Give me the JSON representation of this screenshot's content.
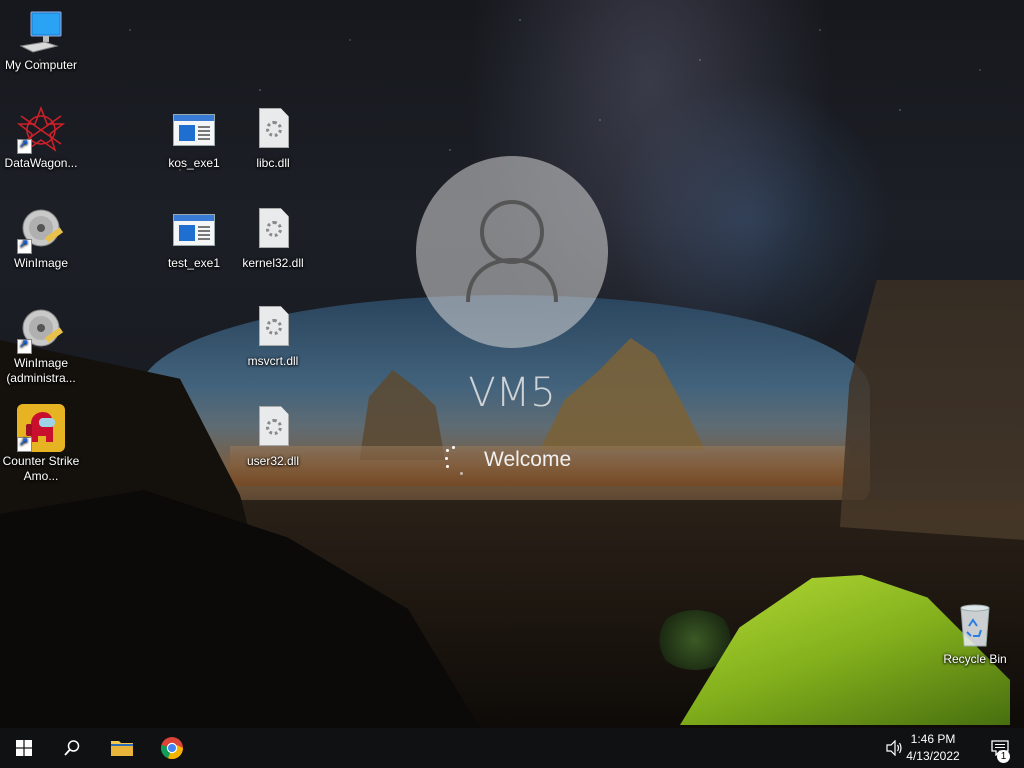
{
  "lockscreen": {
    "username": "VM5",
    "status": "Welcome"
  },
  "desktop": {
    "icons": [
      {
        "label": "My Computer",
        "icon": "computer-icon"
      },
      {
        "label": "DataWagon...",
        "icon": "datawagon-icon"
      },
      {
        "label": "WinImage",
        "icon": "winimage-disc-icon"
      },
      {
        "label": "WinImage (administra...",
        "icon": "winimage-disc-icon"
      },
      {
        "label": "Counter Strike Amo...",
        "icon": "among-us-icon"
      },
      {
        "label": "kos_exe1",
        "icon": "exe-window-icon"
      },
      {
        "label": "test_exe1",
        "icon": "exe-window-icon"
      },
      {
        "label": "libc.dll",
        "icon": "dll-gear-file-icon"
      },
      {
        "label": "kernel32.dll",
        "icon": "dll-gear-file-icon"
      },
      {
        "label": "msvcrt.dll",
        "icon": "dll-gear-file-icon"
      },
      {
        "label": "user32.dll",
        "icon": "dll-gear-file-icon"
      },
      {
        "label": "Recycle Bin",
        "icon": "recycle-bin-icon"
      }
    ]
  },
  "taskbar": {
    "time": "1:46 PM",
    "date": "4/13/2022",
    "notification_count": "1",
    "buttons": [
      "start-button",
      "search-button",
      "file-explorer-button",
      "chrome-button"
    ]
  },
  "colors": {
    "taskbar": "#101113",
    "tent": "#b5e33a",
    "accent_blue": "#1f6fd0"
  }
}
